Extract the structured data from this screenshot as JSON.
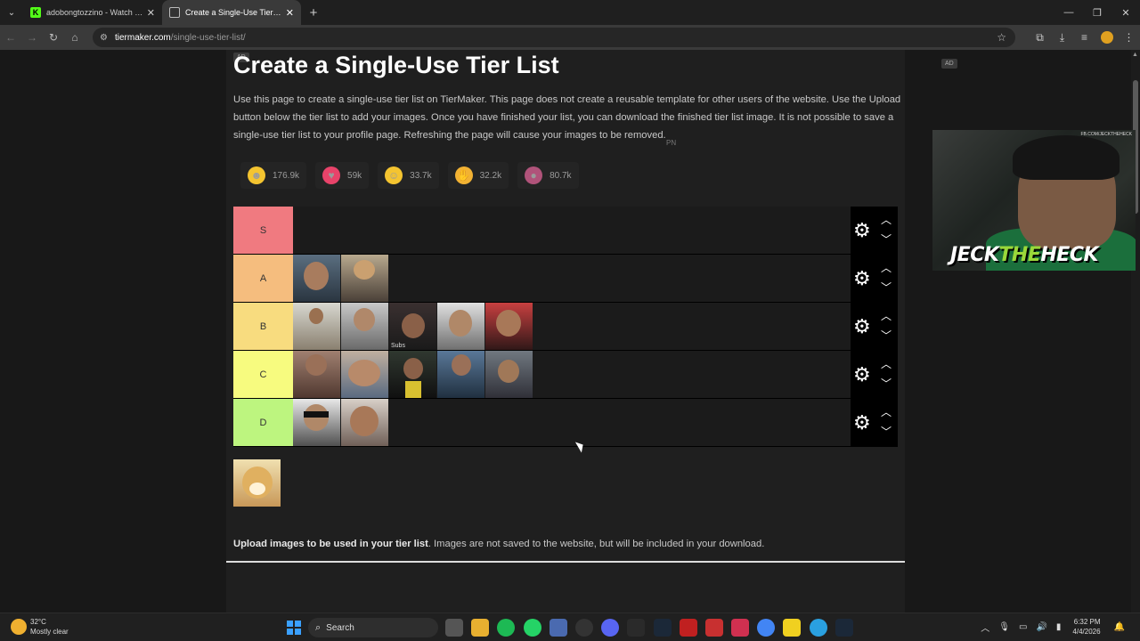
{
  "browser": {
    "tabs": [
      {
        "title": "adobongtozzino - Watch the V",
        "favicon": "kick-icon",
        "active": false
      },
      {
        "title": "Create a Single-Use Tier List (P",
        "favicon": "tiermaker-icon",
        "active": true
      }
    ],
    "url_host": "tiermaker.com",
    "url_path": "/single-use-tier-list/"
  },
  "page": {
    "ad_label": "AD",
    "title": "Create a Single-Use Tier List",
    "intro": "Use this page to create a single-use tier list on TierMaker. This page does not create a reusable template for other users of the website. Use the Upload button below the tier list to add your images. Once you have finished your list, you can download the finished tier list image. It is not possible to save a single-use tier list to your profile page. Refreshing the page will cause your images to be removed.",
    "pn_label": "PN",
    "reactions": [
      {
        "icon": "grin-emoji-icon",
        "count": "176.9k",
        "color": "#f4c430"
      },
      {
        "icon": "heart-eyes-emoji-icon",
        "count": "59k",
        "color": "#e8436a"
      },
      {
        "icon": "laugh-emoji-icon",
        "count": "33.7k",
        "color": "#f4c430"
      },
      {
        "icon": "praise-hands-emoji-icon",
        "count": "32.2k",
        "color": "#f2b233"
      },
      {
        "icon": "poop-emoji-icon",
        "count": "80.7k",
        "color": "#b0537a"
      }
    ],
    "tiers": [
      {
        "label": "S",
        "color": "#f07a80",
        "images": 0
      },
      {
        "label": "A",
        "color": "#f5bd7e",
        "images": 2
      },
      {
        "label": "B",
        "color": "#f8dc7f",
        "images": 5
      },
      {
        "label": "C",
        "color": "#f7fb7f",
        "images": 5
      },
      {
        "label": "D",
        "color": "#bdf57f",
        "images": 2
      }
    ],
    "upload_bold": "Upload images to be used in your tier list",
    "upload_rest": ". Images are not saved to the website, but will be included in your download.",
    "b_tier_overlay": "Subs"
  },
  "webcam": {
    "streamer_name_white1": "JECK",
    "streamer_name_green": "THE",
    "streamer_name_white2": "HECK",
    "tag": "FB.COM/JECKTHEHECK"
  },
  "taskbar": {
    "temp": "32°C",
    "weather": "Mostly clear",
    "search": "Search",
    "time": "6:32 PM",
    "date": "4/4/2026"
  }
}
